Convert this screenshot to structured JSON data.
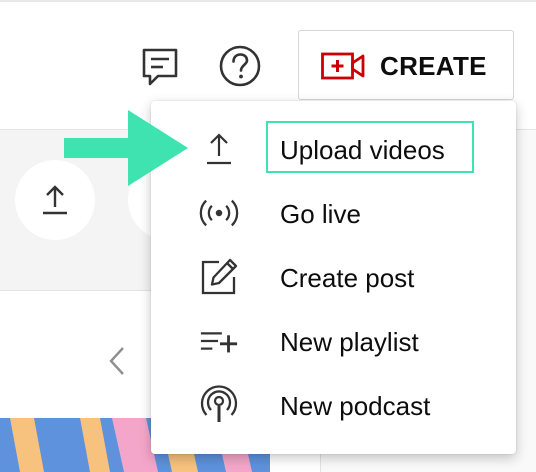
{
  "header": {
    "feedback_icon": "feedback-icon",
    "help_icon": "help-icon",
    "create": {
      "label": "CREATE",
      "icon": "create-video-icon",
      "accent": "#cc0000"
    }
  },
  "background": {
    "quick_action_icon": "upload-icon",
    "nav_icon": "chevron-left-icon"
  },
  "menu": {
    "items": [
      {
        "label": "Upload videos",
        "icon": "upload-icon",
        "highlighted": true
      },
      {
        "label": "Go live",
        "icon": "live-broadcast-icon"
      },
      {
        "label": "Create post",
        "icon": "edit-post-icon"
      },
      {
        "label": "New playlist",
        "icon": "playlist-add-icon"
      },
      {
        "label": "New podcast",
        "icon": "podcast-icon"
      }
    ]
  },
  "annotation": {
    "arrow_color": "#3ee3b0",
    "highlight_color": "#3ee3b0"
  }
}
